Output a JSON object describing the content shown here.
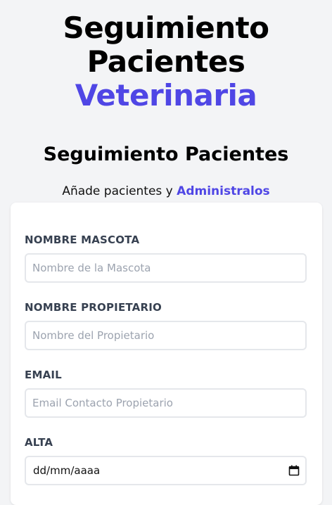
{
  "header": {
    "title_line1": "Seguimiento",
    "title_line2": "Pacientes",
    "title_accent": "Veterinaria"
  },
  "form_section": {
    "title": "Seguimiento Pacientes",
    "subtitle_prefix": "Añade pacientes y ",
    "subtitle_link": "Administralos"
  },
  "form": {
    "fields": [
      {
        "label": "NOMBRE MASCOTA",
        "placeholder": "Nombre de la Mascota",
        "value": ""
      },
      {
        "label": "NOMBRE PROPIETARIO",
        "placeholder": "Nombre del Propietario",
        "value": ""
      },
      {
        "label": "EMAIL",
        "placeholder": "Email Contacto Propietario",
        "value": ""
      },
      {
        "label": "ALTA",
        "display": "dd/mm/aaaa",
        "icon": "calendar-icon"
      }
    ]
  },
  "colors": {
    "accent": "#4f46e5",
    "background": "#f3f4f6",
    "label": "#374151",
    "input_border": "#e5e7eb"
  }
}
